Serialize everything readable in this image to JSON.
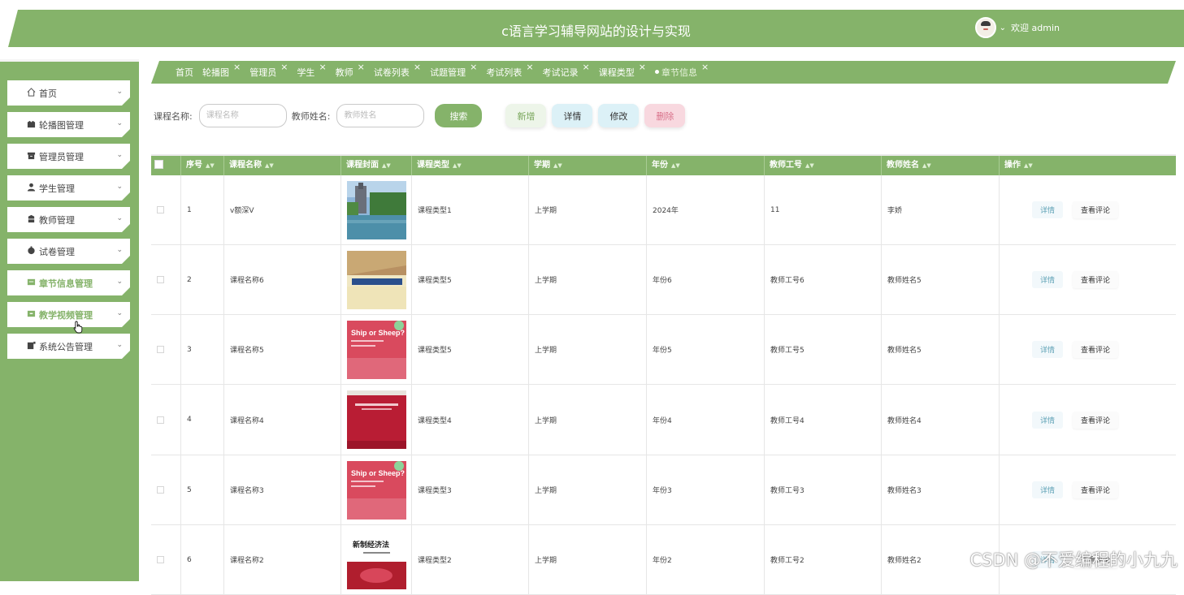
{
  "header": {
    "title": "c语言学习辅导网站的设计与实现",
    "welcome": "欢迎 admin"
  },
  "sidebar": {
    "items": [
      {
        "label": "首页",
        "icon": "home-icon"
      },
      {
        "label": "轮播图管理",
        "icon": "image-icon"
      },
      {
        "label": "管理员管理",
        "icon": "box-icon"
      },
      {
        "label": "学生管理",
        "icon": "user-icon"
      },
      {
        "label": "教师管理",
        "icon": "teacher-icon"
      },
      {
        "label": "试卷管理",
        "icon": "paper-icon"
      },
      {
        "label": "章节信息管理",
        "icon": "chapter-icon"
      },
      {
        "label": "教学视频管理",
        "icon": "video-icon"
      },
      {
        "label": "系统公告管理",
        "icon": "notice-icon"
      }
    ]
  },
  "tabs": [
    {
      "label": "首页",
      "closable": false
    },
    {
      "label": "轮播图",
      "closable": true
    },
    {
      "label": "管理员",
      "closable": true
    },
    {
      "label": "学生",
      "closable": true
    },
    {
      "label": "教师",
      "closable": true
    },
    {
      "label": "试卷列表",
      "closable": true
    },
    {
      "label": "试题管理",
      "closable": true
    },
    {
      "label": "考试列表",
      "closable": true
    },
    {
      "label": "考试记录",
      "closable": true
    },
    {
      "label": "课程类型",
      "closable": true
    },
    {
      "label": "章节信息",
      "closable": true,
      "active": true
    }
  ],
  "search": {
    "course_label": "课程名称:",
    "course_placeholder": "课程名称",
    "teacher_label": "教师姓名:",
    "teacher_placeholder": "教师姓名",
    "search_btn": "搜索",
    "add_btn": "新增",
    "detail_btn": "详情",
    "edit_btn": "修改",
    "delete_btn": "删除"
  },
  "table": {
    "columns": [
      "序号",
      "课程名称",
      "课程封面",
      "课程类型",
      "学期",
      "年份",
      "教师工号",
      "教师姓名",
      "操作"
    ],
    "op_detail": "详情",
    "op_review": "查看评论",
    "rows": [
      {
        "no": "1",
        "name": "v额深V",
        "type": "课程类型1",
        "term": "上学期",
        "year": "2024年",
        "tid": "11",
        "tname": "李娇",
        "cover": "campus-lake"
      },
      {
        "no": "2",
        "name": "课程名称6",
        "type": "课程类型5",
        "term": "上学期",
        "year": "年份6",
        "tid": "教师工号6",
        "tname": "教师姓名5",
        "cover": "textbook-yellow"
      },
      {
        "no": "3",
        "name": "课程名称5",
        "type": "课程类型5",
        "term": "上学期",
        "year": "年份5",
        "tid": "教师工号5",
        "tname": "教师姓名5",
        "cover": "ship-or-sheep"
      },
      {
        "no": "4",
        "name": "课程名称4",
        "type": "课程类型4",
        "term": "上学期",
        "year": "年份4",
        "tid": "教师工号4",
        "tname": "教师姓名4",
        "cover": "red-book"
      },
      {
        "no": "5",
        "name": "课程名称3",
        "type": "课程类型3",
        "term": "上学期",
        "year": "年份3",
        "tid": "教师工号3",
        "tname": "教师姓名3",
        "cover": "ship-or-sheep"
      },
      {
        "no": "6",
        "name": "课程名称2",
        "type": "课程类型2",
        "term": "上学期",
        "year": "年份2",
        "tid": "教师工号2",
        "tname": "教师姓名2",
        "cover": "economics-book"
      }
    ]
  },
  "covers": {
    "ship_title": "Ship or Sheep?",
    "economics_title": "新制经济法"
  },
  "watermark": "CSDN @不爱编程的小九九",
  "colors": {
    "accent": "#85b36a",
    "detail": "#5da1b5",
    "delete": "#d9718a"
  }
}
